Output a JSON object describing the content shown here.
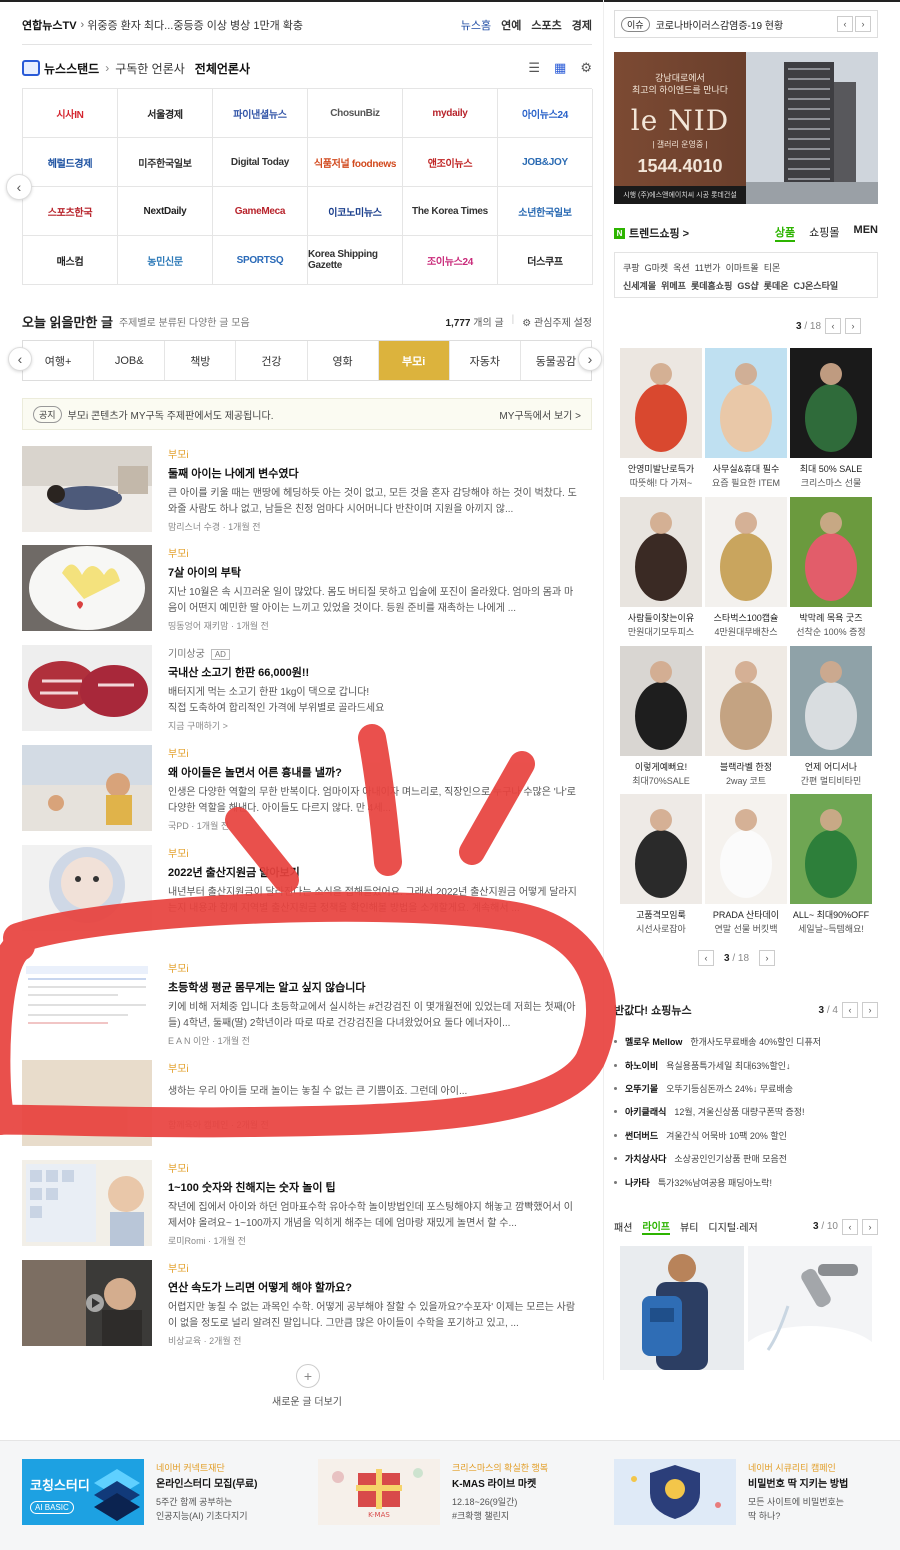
{
  "ticker": {
    "source": "연합뉴스TV",
    "headline": "위중증 환자 최다...중등증 이상 병상 1만개 확충",
    "links": [
      "뉴스홈",
      "연예",
      "스포츠",
      "경제"
    ]
  },
  "newsstand": {
    "title": "뉴스스탠드",
    "subscribed": "구독한 언론사",
    "all": "전체언론사",
    "press": [
      "시사IN",
      "서울경제",
      "파이낸셜뉴스",
      "ChosunBiz",
      "mydaily",
      "아이뉴스24",
      "헤럴드경제",
      "미주한국일보",
      "Digital Today",
      "식품저널 foodnews",
      "앤조이뉴스",
      "JOB&JOY",
      "스포츠한국",
      "NextDaily",
      "GameMeca",
      "이코노미뉴스",
      "The Korea Times",
      "소년한국일보",
      "매스컴",
      "농민신문",
      "SPORTSQ",
      "Korea Shipping Gazette",
      "조이뉴스24",
      "더스쿠프"
    ]
  },
  "today": {
    "title": "오늘 읽을만한 글",
    "subtitle": "주제별로 분류된 다양한 글 모음",
    "count": "1,777",
    "count_unit": "개의 글",
    "settings": "관심주제 설정",
    "tabs": [
      "여행+",
      "JOB&",
      "책방",
      "건강",
      "영화",
      "부모i",
      "자동차",
      "동물공감"
    ],
    "active_tab": "부모i"
  },
  "notice": {
    "tag": "공지",
    "text": "부모i 콘텐츠가 MY구독 주제판에서도 제공됩니다.",
    "link": "MY구독에서 보기 >"
  },
  "articles": [
    {
      "cat": "부모i",
      "title": "둘째 아이는 나에게 변수였다",
      "desc": "큰 아이를 키울 때는 맨땅에 헤딩하듯 아는 것이 없고, 모든 것을 혼자 감당해야 하는 것이 벅찼다. 도와줄 사람도 하나 없고, 남들은 친정 엄마다 시어머니다 반찬이며 지원을 아끼지 않...",
      "meta": "맘리스너 수경 · 1개월 전"
    },
    {
      "cat": "부모i",
      "title": "7살 아이의 부탁",
      "desc": "지난 10월은 속 시끄러운 일이 많았다. 몸도 버티질 못하고 입술에 포진이 올라왔다. 엄마의 몸과 마음이 어떤지 예민한 딸 아이는 느끼고 있었을 것이다. 등원 준비를 재촉하는 나에게 ...",
      "meta": "띵동엉어 재키맘 · 1개월 전"
    },
    {
      "cat": "기미상궁",
      "ad": "AD",
      "title": "국내산 소고기 한판 66,000원!!",
      "desc": "배터지게 먹는 소고기 한판 1kg이 댁으로 갑니다!\n직접 도축하여 합리적인 가격에 부위별로 골라드세요",
      "meta": "지금 구매하기 >"
    },
    {
      "cat": "부모i",
      "title": "왜 아이들은 놀면서 어른 흉내를 낼까?",
      "desc": "인생은 다양한 역할의 무한 반복이다. 엄마이자 아내이자 며느리로, 직장인으로 누구나 수많은 '나'로 다양한 역할을 해낸다. 아이들도 다르지 않다. 만 4세...",
      "meta": "국PD · 1개월 전"
    },
    {
      "cat": "부모i",
      "title": "2022년 출산지원금 알아보기",
      "desc": "내년부터 출산지원금이 달라진다는 소식을 접해들었어요. 그래서 2022년 출산지원금 어떻게 달라지는지 내용과 함께 지역별 출산지원금 정책을 확인해볼 방법을 소개할게요. 계속해서 ...",
      "meta": ""
    },
    {
      "cat": "부모i",
      "title": "초등학생 평균 몸무게는 알고 싶지 않습니다",
      "desc": "키에 비해 저체중 입니다 초등학교에서 실시하는 #건강검진 이 몇개월전에 있었는데 저희는 첫째(아들) 4학년, 둘째(딸) 2학년이라 따로 따로 건강검진을 다녀왔었어요 둘다 에너자이...",
      "meta": "E A N 이안 · 1개월 전"
    },
    {
      "cat": "부모i",
      "title": "",
      "desc": "생하는 우리 아이들 모래 놀이는 놓칠 수 없는 큰 기쁨이죠. 그런데 아이...",
      "meta": "함께육아 캠페인 · 2개월 전"
    },
    {
      "cat": "부모i",
      "title": "1~100 숫자와 친해지는 숫자 놀이 팁",
      "desc": "작년에 집에서 아이와 하던 엄마표수학 유아수학 놀이방법인데 포스팅해야지 해놓고 깜빡했어서 이제서야 올려요~ 1~100까지 개념을 익히게 해주는 데에 엄마랑 재밌게 놀면서 할 수...",
      "meta": "로미Romi · 1개월 전"
    },
    {
      "cat": "부모i",
      "title": "연산 속도가 느리면 어떻게 해야 할까요?",
      "desc": "어렵지만 놓칠 수 없는 과목인 수학. 어떻게 공부해야 잘할 수 있을까요?'수포자' 이제는 모르는 사람이 없을 정도로 널리 알려진 말입니다. 그만큼 많은 아이들이 수학을 포기하고 있고, ...",
      "meta": "비상교육 · 2개월 전"
    }
  ],
  "more": {
    "label": "새로운 글 더보기"
  },
  "issue": {
    "tag": "이슈",
    "text": "코로나바이러스감염증-19 현황"
  },
  "banner": {
    "line1": "강남대로에서",
    "line2": "최고의 하이엔드를 만나다",
    "logo": "le NID",
    "sub": "| 갤러리 운영중 |",
    "phone": "1544.4010",
    "foot": "시행 (주)에스앤에이치씨 시공 롯데건설"
  },
  "trend": {
    "title": "트렌드쇼핑 >",
    "tabs": [
      "상품",
      "쇼핑몰",
      "MEN"
    ],
    "active": "상품",
    "malls": [
      "쿠팡",
      "G마켓",
      "옥션",
      "11번가",
      "이마트몰",
      "티몬",
      "신세계몰",
      "위메프",
      "롯데홈쇼핑",
      "GS샵",
      "롯데온",
      "CJ온스타일"
    ],
    "page": "3",
    "pages": "/ 18",
    "products": [
      {
        "l1": "안영미발난로득가",
        "l2": "따뜻해! 다 가져~"
      },
      {
        "l1": "사무실&휴대 필수",
        "l2": "요즘 필요한 ITEM"
      },
      {
        "l1": "최대 50% SALE",
        "l2": "크리스마스 선물"
      },
      {
        "l1": "사람들이찾는이유",
        "l2": "만원대기모두피스"
      },
      {
        "l1": "스타벅스100캡슐",
        "l2": "4만원대무배찬스"
      },
      {
        "l1": "박막례 목욕 굿즈",
        "l2": "선착순 100% 증정"
      },
      {
        "l1": "이렇게예뻐요!",
        "l2": "최대70%SALE"
      },
      {
        "l1": "블랙라벨 한정",
        "l2": "2way 코트"
      },
      {
        "l1": "언제 어디서나",
        "l2": "간편 멀티비타민"
      },
      {
        "l1": "고품격모임룩",
        "l2": "시선사로잡아"
      },
      {
        "l1": "PRADA 산타데이",
        "l2": "연말 선물 버킷백"
      },
      {
        "l1": "ALL~ 최대90%OFF",
        "l2": "세일날~득템해요!"
      }
    ]
  },
  "shopnews": {
    "title": "반값다! 쇼핑뉴스",
    "page": "3",
    "pages": "/ 4",
    "items": [
      {
        "b": "멜로우 Mellow",
        "t": "한개사도무료배송 40%할인 디퓨저"
      },
      {
        "b": "하노이비",
        "t": "욕실용품특가세일 최대63%할인↓"
      },
      {
        "b": "오뚜기몰",
        "t": "오뚜기등심돈까스 24%↓ 무료배송"
      },
      {
        "b": "아키클래식",
        "t": "12월, 겨울신상품 대량구폰딱 증정!"
      },
      {
        "b": "썬더버드",
        "t": "겨울간식 어묵바 10팩 20% 할인"
      },
      {
        "b": "가치상사다",
        "t": "소상공인인기상품 판매 모음전"
      },
      {
        "b": "나카타",
        "t": "특가32%남여공용 패딩아노락!"
      }
    ]
  },
  "cats": {
    "items": [
      "패션",
      "라이프",
      "뷰티",
      "디지털·레저"
    ],
    "active": "라이프",
    "page": "3",
    "pages": "/ 10"
  },
  "footer": [
    {
      "img_title": "코칭스터디",
      "img_sub": "AI BASIC",
      "c": "네이버 커넥트재단",
      "h": "온라인스터디 모집(무료)",
      "d1": "5주간 함께 공부하는",
      "d2": "인공지능(AI) 기초다지기"
    },
    {
      "img_title": "크리스마스 선물 K-MAS",
      "c": "크리스마스의 확실한 행복",
      "h": "K-MAS 라이브 마켓",
      "d1": "12.18~26(9일간)",
      "d2": "#크확행 챌린지"
    },
    {
      "c": "네이버 시큐리티 캠페인",
      "h": "비밀번호 딱 지키는 방법",
      "d1": "모든 사이트에 비밀번호는",
      "d2": "딱 하나?"
    }
  ],
  "colors": {
    "accent_gold": "#dcb33d",
    "naver_green": "#2db400",
    "category": "#e29e27",
    "red_marker": "#e8433f"
  }
}
